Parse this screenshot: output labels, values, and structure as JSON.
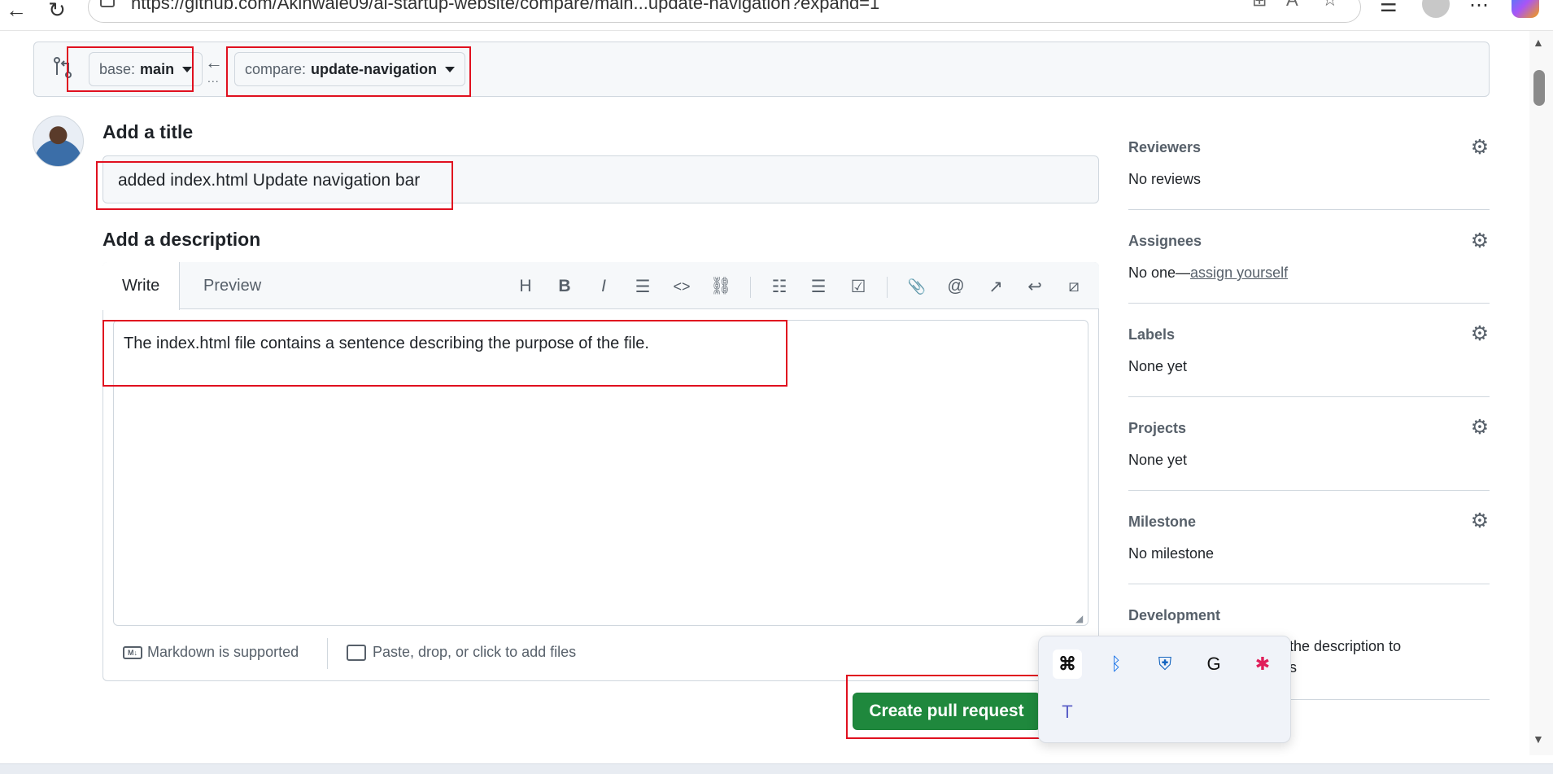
{
  "browser": {
    "url": "https://github.com/Akinwale09/ai-startup-website/compare/main...update-navigation?expand=1"
  },
  "branches": {
    "base_prefix": "base:",
    "base_name": "main",
    "compare_prefix": "compare:",
    "compare_name": "update-navigation",
    "swap_dots": "..."
  },
  "form": {
    "title_heading": "Add a title",
    "title_value": "added index.html Update navigation bar",
    "description_heading": "Add a description",
    "tabs": [
      {
        "label": "Write"
      },
      {
        "label": "Preview"
      }
    ],
    "toolbar": [
      {
        "icon": "heading-icon",
        "glyph": "H"
      },
      {
        "icon": "bold-icon",
        "glyph": "B"
      },
      {
        "icon": "italic-icon",
        "glyph": "I"
      },
      {
        "icon": "quote-icon",
        "glyph": "☰"
      },
      {
        "icon": "code-icon",
        "glyph": "<>"
      },
      {
        "icon": "link-icon",
        "glyph": "⛓"
      },
      {
        "icon": "numbered-list-icon",
        "glyph": "☷"
      },
      {
        "icon": "unordered-list-icon",
        "glyph": "☰"
      },
      {
        "icon": "task-list-icon",
        "glyph": "☑"
      },
      {
        "icon": "attach-icon",
        "glyph": "📎"
      },
      {
        "icon": "mention-icon",
        "glyph": "@"
      },
      {
        "icon": "reference-icon",
        "glyph": "↗"
      },
      {
        "icon": "reply-icon",
        "glyph": "↩"
      },
      {
        "icon": "slash-command-icon",
        "glyph": "⧄"
      }
    ],
    "description_value": "The index.html file contains a sentence describing the purpose of the file.",
    "markdown_note": "Markdown is supported",
    "attach_note": "Paste, drop, or click to add files",
    "submit_label": "Create pull request"
  },
  "sidebar": {
    "reviewers_label": "Reviewers",
    "reviewers_value": "No reviews",
    "assignees_label": "Assignees",
    "assignees_prefix": "No one—",
    "assignees_link": "assign yourself",
    "labels_label": "Labels",
    "labels_value": "None yet",
    "projects_label": "Projects",
    "projects_value": "None yet",
    "milestone_label": "Milestone",
    "milestone_value": "No milestone",
    "development_label": "Development",
    "development_line1": "the description to",
    "development_line2": "s"
  },
  "tray": {
    "icons": [
      "app-icon",
      "bluetooth-icon",
      "defender-warning-icon",
      "grammarly-icon",
      "slack-icon",
      "teams-icon"
    ]
  },
  "colors": {
    "accent_green": "#1f883d",
    "highlight_red": "#e0101f"
  }
}
